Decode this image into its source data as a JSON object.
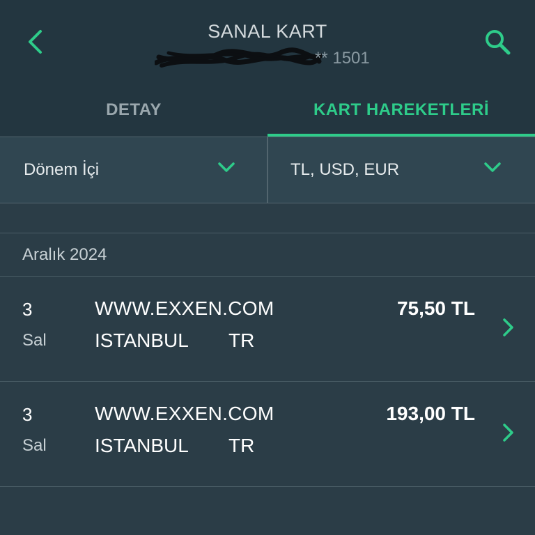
{
  "header": {
    "title": "SANAL KART",
    "card_number_suffix": "** 1501",
    "back_icon": "chevron-left-icon",
    "search_icon": "search-icon"
  },
  "tabs": [
    {
      "label": "DETAY",
      "active": false
    },
    {
      "label": "KART HAREKETLERİ",
      "active": true
    }
  ],
  "filters": {
    "period": {
      "value": "Dönem İçi"
    },
    "currency": {
      "value": "TL, USD, EUR"
    }
  },
  "section": {
    "title": "Aralık 2024"
  },
  "transactions": [
    {
      "day": "3",
      "weekday": "Sal",
      "merchant": "WWW.EXXEN.COM",
      "city": "ISTANBUL",
      "country": "TR",
      "amount": "75,50 TL"
    },
    {
      "day": "3",
      "weekday": "Sal",
      "merchant": "WWW.EXXEN.COM",
      "city": "ISTANBUL",
      "country": "TR",
      "amount": "193,00 TL"
    }
  ],
  "colors": {
    "accent": "#2ecc8a",
    "background": "#2b3d47",
    "header_background": "#233640"
  }
}
